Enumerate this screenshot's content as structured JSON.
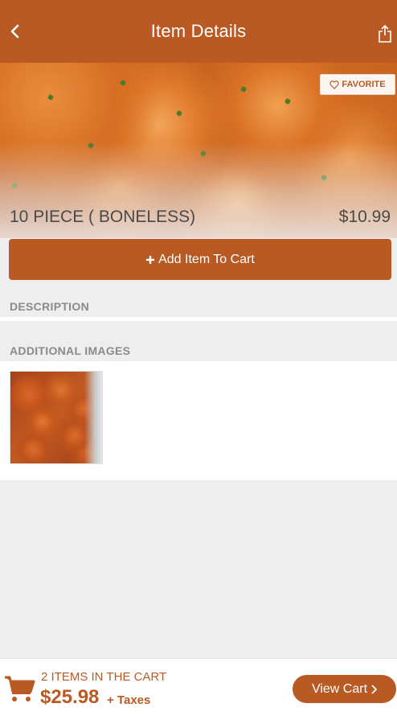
{
  "header": {
    "title": "Item Details",
    "back_icon": "back-arrow-icon",
    "share_icon": "share-icon"
  },
  "item": {
    "name": "10 PIECE ( BONELESS)",
    "price": "$10.99"
  },
  "favorite": {
    "label": "FAVORITE",
    "icon": "heart-outline-icon"
  },
  "add_button": {
    "label": "Add Item To Cart",
    "icon": "plus-icon"
  },
  "sections": {
    "description": "DESCRIPTION",
    "additional_images": "ADDITIONAL IMAGES"
  },
  "cart": {
    "count_text": "2 ITEMS IN THE CART",
    "total": "$25.98",
    "taxes_text": "+ Taxes",
    "view_label": "View Cart",
    "icon": "shopping-cart-icon"
  },
  "colors": {
    "brand": "#b95a24",
    "background": "#eeeeee"
  }
}
